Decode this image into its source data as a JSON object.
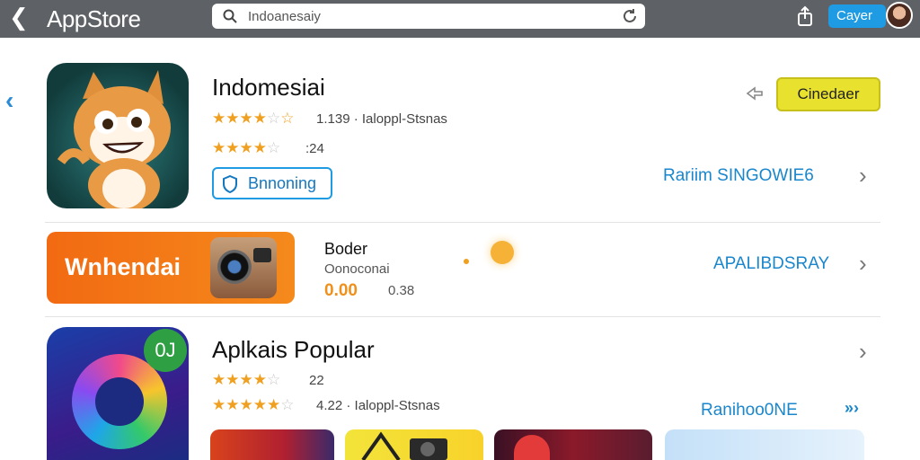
{
  "topbar": {
    "title": "AppStore",
    "search_value": "Indoanesaiy",
    "user_label": "Cayer"
  },
  "featured": {
    "name": "Indomesiai",
    "rating_line1": "1.139 · Ialoppl-Stsnas",
    "rating_line2": ":24",
    "tag_label": "Bnnoning",
    "get_label": "Cinedaer",
    "link_label": "Rariim SINGOWIE6",
    "stars1": 4.5,
    "stars2": 4.5
  },
  "banner_row": {
    "banner_text": "Wnhendai",
    "title": "Boder",
    "subtitle": "Oonoconai",
    "price": "0.00",
    "count": "0.38",
    "link_label": "APALIBDSRAY"
  },
  "popular": {
    "title": "Aplkais Popular",
    "badge_text": "0J",
    "rating_line1": "22",
    "rating_line2": "4.22 · Ialoppl-Stsnas",
    "link_label": "Ranihoo0NE",
    "stars1": 4.5,
    "stars2": 5
  },
  "colors": {
    "accent": "#1e9be3",
    "get_button": "#e8e22e",
    "star": "#f0a020",
    "topbar": "#5e6165"
  },
  "icons": [
    "back-icon",
    "search-icon",
    "refresh-icon",
    "share-icon",
    "avatar",
    "chevron-right-icon",
    "pin-icon"
  ]
}
